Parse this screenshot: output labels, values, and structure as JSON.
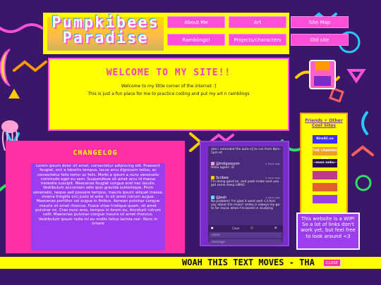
{
  "site": {
    "title_line1": "Pumpkibees",
    "title_line2": "Paradise"
  },
  "nav": [
    {
      "label": "About Me"
    },
    {
      "label": "Art"
    },
    {
      "label": "Site Map"
    },
    {
      "label": "Ramblings!"
    },
    {
      "label": "Projects/characters"
    },
    {
      "label": "Old site"
    }
  ],
  "welcome": {
    "heading": "WELCOME TO MY SITE!!",
    "line1": "Welcome to my little corner of the internet :]",
    "line2": "This is just a fun place for me to practice coding and put my art n ramblings"
  },
  "changelog": {
    "heading": "CHANGELOG",
    "text": "Lorem ipsum dolor sit amet, consectetur adipiscing elit. Praesent feugiat, orci a lobortis tempus, lacus arcu dignissim tellus, ac consectetur felis tortor ac felis. Morbi a ipsum a nunc venenatis commodo eget eu sem. Suspendisse sit amet arcu id massa molestie suscipit. Maecenas feugiat congue erat nec iaculis. Vestibulum accumsan odio quis gravida scelerisque. Proin venenatis, neque sed posuere tempus, mauris ipsum aliquet massa, viverra fringilla orci justo id ante. In sit amet rutrum augue. Maecenas porttitor vel augue in finibus. Aenean pulvinar congue mauris sit amet rhoncus. Fusce vitae tristique quam, sit amet pulvinar mi. Cras nunc eros, tempus in lorem eu, tincidunt rutrum velit. Maecenas pulvinar congue mauris sit amet rhoncus. Vestibulum ipsum nulla mi eu mollis tellus lacinia non. Nunc in ornare"
  },
  "chat": {
    "messages": [
      {
        "name": "",
        "time": "",
        "text": "also i extended the auto-clj to run from 8pm-1pm et"
      },
      {
        "name": "@indigozayon",
        "time": "4 days ago",
        "text": "Hello again! :D"
      },
      {
        "name": "Scribee",
        "time": "4 days ago",
        "text": "I'm doing good lol, and yeah make sure you get some sleep LMAO"
      },
      {
        "name": "@jeah",
        "time": "4 days ago",
        "text": "No problem! I'm glad it went well <3 And yay about the music! embu is always my go-to for music when I'm bored or studying"
      }
    ],
    "toolbar_label": "Clear",
    "name_placeholder": "name",
    "message_placeholder": "message"
  },
  "friends": {
    "heading": "Friends + Other Cool Sites",
    "buttons": [
      {
        "label": "KiroSC.co",
        "color": "#3b2cff"
      },
      {
        "label": "THE CRANING BOX",
        "color": "#f0a020"
      },
      {
        "label": "~neon nebu~",
        "color": "#2a0d4a"
      },
      {
        "label": "",
        "color": "#c0398a"
      },
      {
        "label": "",
        "color": "#e06030"
      },
      {
        "label": "",
        "color": "#9a40e0"
      }
    ]
  },
  "notice": {
    "text": "This website is a WIP! So a lot of links don't work yet, but feel free to look around <3"
  },
  "marquee": {
    "text": "WOAH THIS TEXT MOVES - THA",
    "close_label": "CLOSE"
  },
  "colors": {
    "yellow": "#ffff00",
    "pink": "#ff2fa6",
    "purple": "#9c3df0",
    "background": "#3a1769"
  }
}
